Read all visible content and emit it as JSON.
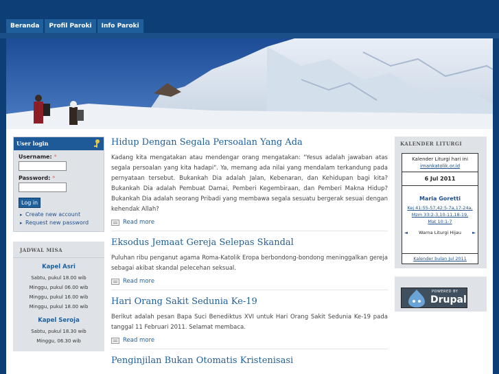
{
  "nav": {
    "items": [
      "Beranda",
      "Profil Paroki",
      "Info Paroki"
    ]
  },
  "login": {
    "title": "User login",
    "username_label": "Username:",
    "password_label": "Password:",
    "required_mark": "*",
    "button": "Log in",
    "links": [
      "Create new account",
      "Request new password"
    ]
  },
  "jadwal": {
    "title": "JADWAL MISA",
    "chapels": [
      {
        "name": "Kapel Asri",
        "times": [
          "Sabtu, pukul 18.00 wib",
          "Minggu, pukul 06.00 wib",
          "Minggu, pukul 16.00 wib",
          "Minggu, pukul 18.00 wib"
        ]
      },
      {
        "name": "Kapel Seroja",
        "times": [
          "Sabtu, pukul 18.30 wib",
          "Minggu, 06.30 wib"
        ]
      }
    ]
  },
  "articles": [
    {
      "title": "Hidup Dengan Segala Persoalan Yang Ada",
      "text": "Kadang kita mengatakan atau mendengar orang mengatakan: \"Yesus adalah jawaban atas segala persoalan yang kita hadapi\". Ya, memang ada nilai yang mendalam terkandung pada pernyataan tersebut. Bukankah Dia adalah Jalan, Kebenaran, dan Kehidupan bagi kita? Bukankah Dia adalah Pembuat Damai, Pemberi Kegembiraan, dan Pemberi Makna Hidup? Bukankah Dia adalah seorang Pribadi yang membawa segala sesuatu bergerak sesuai dengan kehendak Allah?",
      "readmore": "Read more"
    },
    {
      "title": "Eksodus Jemaat Gereja Selepas Skandal",
      "text": "Puluhan ribu penganut agama Roma-Katolik Eropa berbondong-bondong meninggalkan gereja sebagai akibat skandal pelecehan seksual.",
      "readmore": "Read more"
    },
    {
      "title": "Hari Orang Sakit Sedunia Ke-19",
      "text": "Berikut adalah pesan Bapa Suci Benediktus XVI untuk Hari Orang Sakit Sedunia Ke-19 pada tanggal 11 Februari 2011. Selamat membaca.",
      "readmore": "Read more"
    },
    {
      "title": "Penginjilan Bukan Otomatis Kristenisasi"
    }
  ],
  "kalender": {
    "title": "KALENDER LITURGI",
    "intro": "Kalender Liturgi hari ini",
    "site": "imankatolik.or.id",
    "date": "6 Jul 2011",
    "saint": "Maria Goretti",
    "readings": [
      "Kej 41:55-57,42:5-7a,17-24a,",
      "Mzm 33:2-3,10-11,18-19,",
      "Mat 10:1-7"
    ],
    "color": "Warna Liturgi Hijau",
    "prev": "◄",
    "next": "►",
    "footer": "Kalender bulan Jul 2011"
  },
  "badge": {
    "powered": "POWERED BY",
    "name": "Drupal"
  },
  "colors": {
    "header_blue": "#0d3f76",
    "accent_blue": "#1f5f9a",
    "sidebar_gray": "#dfe3e8"
  }
}
